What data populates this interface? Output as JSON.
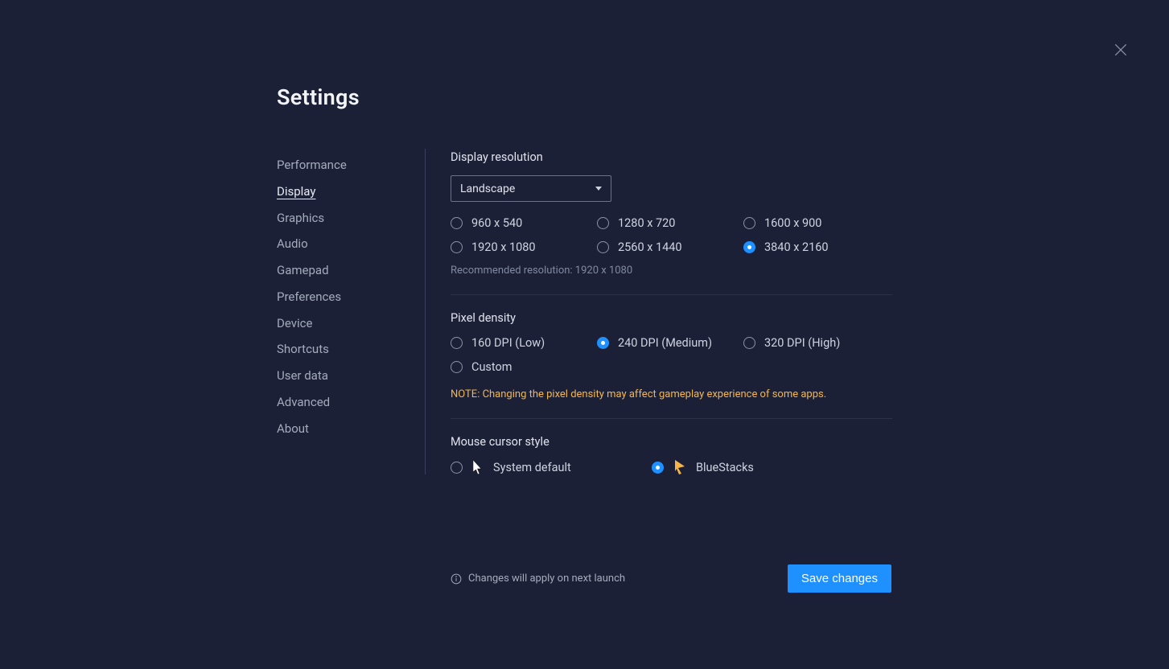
{
  "title": "Settings",
  "sidebar": {
    "items": [
      {
        "label": "Performance"
      },
      {
        "label": "Display"
      },
      {
        "label": "Graphics"
      },
      {
        "label": "Audio"
      },
      {
        "label": "Gamepad"
      },
      {
        "label": "Preferences"
      },
      {
        "label": "Device"
      },
      {
        "label": "Shortcuts"
      },
      {
        "label": "User data"
      },
      {
        "label": "Advanced"
      },
      {
        "label": "About"
      }
    ],
    "activeIndex": 1
  },
  "display": {
    "resolution_label": "Display resolution",
    "orientation_select": "Landscape",
    "resolutions": [
      {
        "label": "960 x 540"
      },
      {
        "label": "1280 x 720"
      },
      {
        "label": "1600 x 900"
      },
      {
        "label": "1920 x 1080"
      },
      {
        "label": "2560 x 1440"
      },
      {
        "label": "3840 x 2160"
      }
    ],
    "selected_resolution": "3840 x 2160",
    "recommended": "Recommended resolution: 1920 x 1080"
  },
  "pixel_density": {
    "label": "Pixel density",
    "options": [
      {
        "label": "160 DPI (Low)"
      },
      {
        "label": "240 DPI (Medium)"
      },
      {
        "label": "320 DPI (High)"
      },
      {
        "label": "Custom"
      }
    ],
    "selected": "240 DPI (Medium)",
    "note": "NOTE: Changing the pixel density may affect gameplay experience of some apps."
  },
  "cursor": {
    "label": "Mouse cursor style",
    "options": [
      {
        "label": "System default"
      },
      {
        "label": "BlueStacks"
      }
    ],
    "selected": "BlueStacks"
  },
  "footer": {
    "note": "Changes will apply on next launch",
    "save": "Save changes"
  }
}
